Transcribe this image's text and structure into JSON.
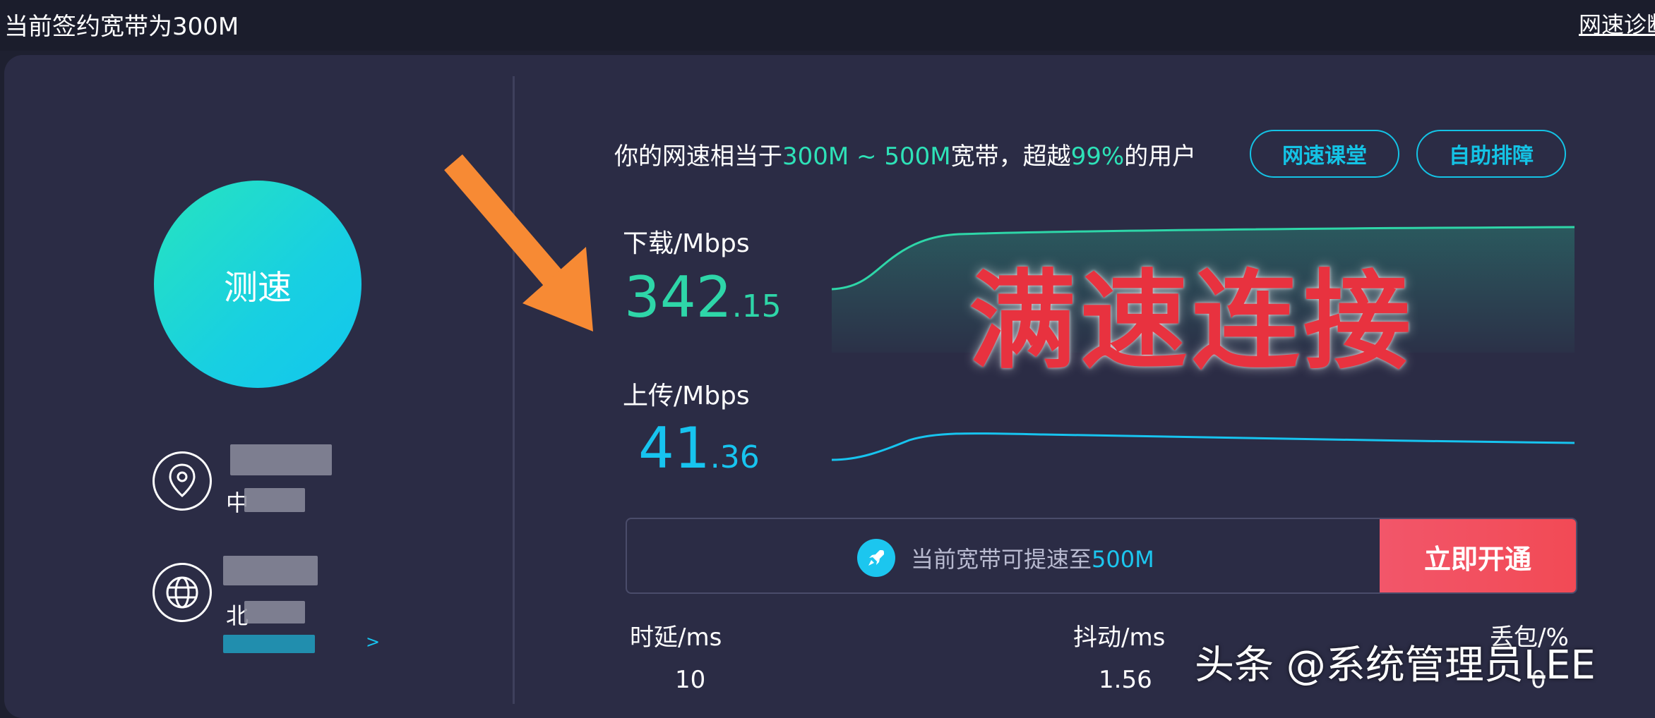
{
  "header": {
    "plan_text": "当前签约宽带为300M",
    "diagnose_link": "网速诊断"
  },
  "left": {
    "speed_button": "测速",
    "location_line2_prefix": "中",
    "network_line2_prefix": "北",
    "more_chevron": ">"
  },
  "summary": {
    "prefix": "你的网速相当于",
    "range": "300M ~ 500M",
    "middle": "宽带，超越",
    "percent": "99%",
    "suffix": "的用户"
  },
  "buttons": {
    "speed_class": "网速课堂",
    "self_help": "自助排障"
  },
  "download": {
    "label": "下载/Mbps",
    "value_int": "342",
    "value_dec": ".15"
  },
  "upload": {
    "label": "上传/Mbps",
    "value_int": "41",
    "value_dec": ".36"
  },
  "overlay_text": "满速连接",
  "upgrade": {
    "text_prefix": "当前宽带可提速至",
    "text_value": "500M",
    "button": "立即开通"
  },
  "stats": {
    "latency_label": "时延/ms",
    "latency_value": "10",
    "jitter_label": "抖动/ms",
    "jitter_value": "1.56",
    "loss_label": "丢包/%",
    "loss_value": "0"
  },
  "watermark": "头条 @系统管理员LEE",
  "colors": {
    "background": "#2b2c45",
    "accent_green": "#2ee2b8",
    "accent_cyan": "#17c4ef",
    "button_red": "#f24a55",
    "overlay_red": "#e8323f",
    "arrow_orange": "#f78a34"
  }
}
